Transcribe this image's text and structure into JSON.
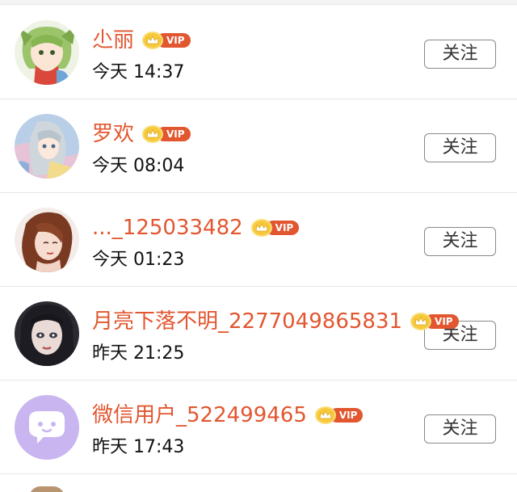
{
  "users": [
    {
      "name": "尐丽",
      "vip": "VIP",
      "time": "今天 14:37",
      "follow": "关注"
    },
    {
      "name": "罗欢",
      "vip": "VIP",
      "time": "今天 08:04",
      "follow": "关注"
    },
    {
      "name": "..._125033482",
      "vip": "VIP",
      "time": "今天 01:23",
      "follow": "关注"
    },
    {
      "name": "月亮下落不明_2277049865831",
      "vip": "VIP",
      "time": "昨天 21:25",
      "follow": "关注"
    },
    {
      "name": "微信用户_522499465",
      "vip": "VIP",
      "time": "昨天 17:43",
      "follow": "关注"
    }
  ],
  "colors": {
    "name": "#e25630",
    "vip_badge": "#e25630",
    "crown": "#f7c93a",
    "wechat_avatar_bg": "#c9b6f0"
  },
  "icons": [
    "avatar-anime-green-hair",
    "avatar-anime-silver-hair",
    "avatar-woman-portrait",
    "avatar-doll-face",
    "wechat-default-avatar",
    "crown-icon"
  ]
}
